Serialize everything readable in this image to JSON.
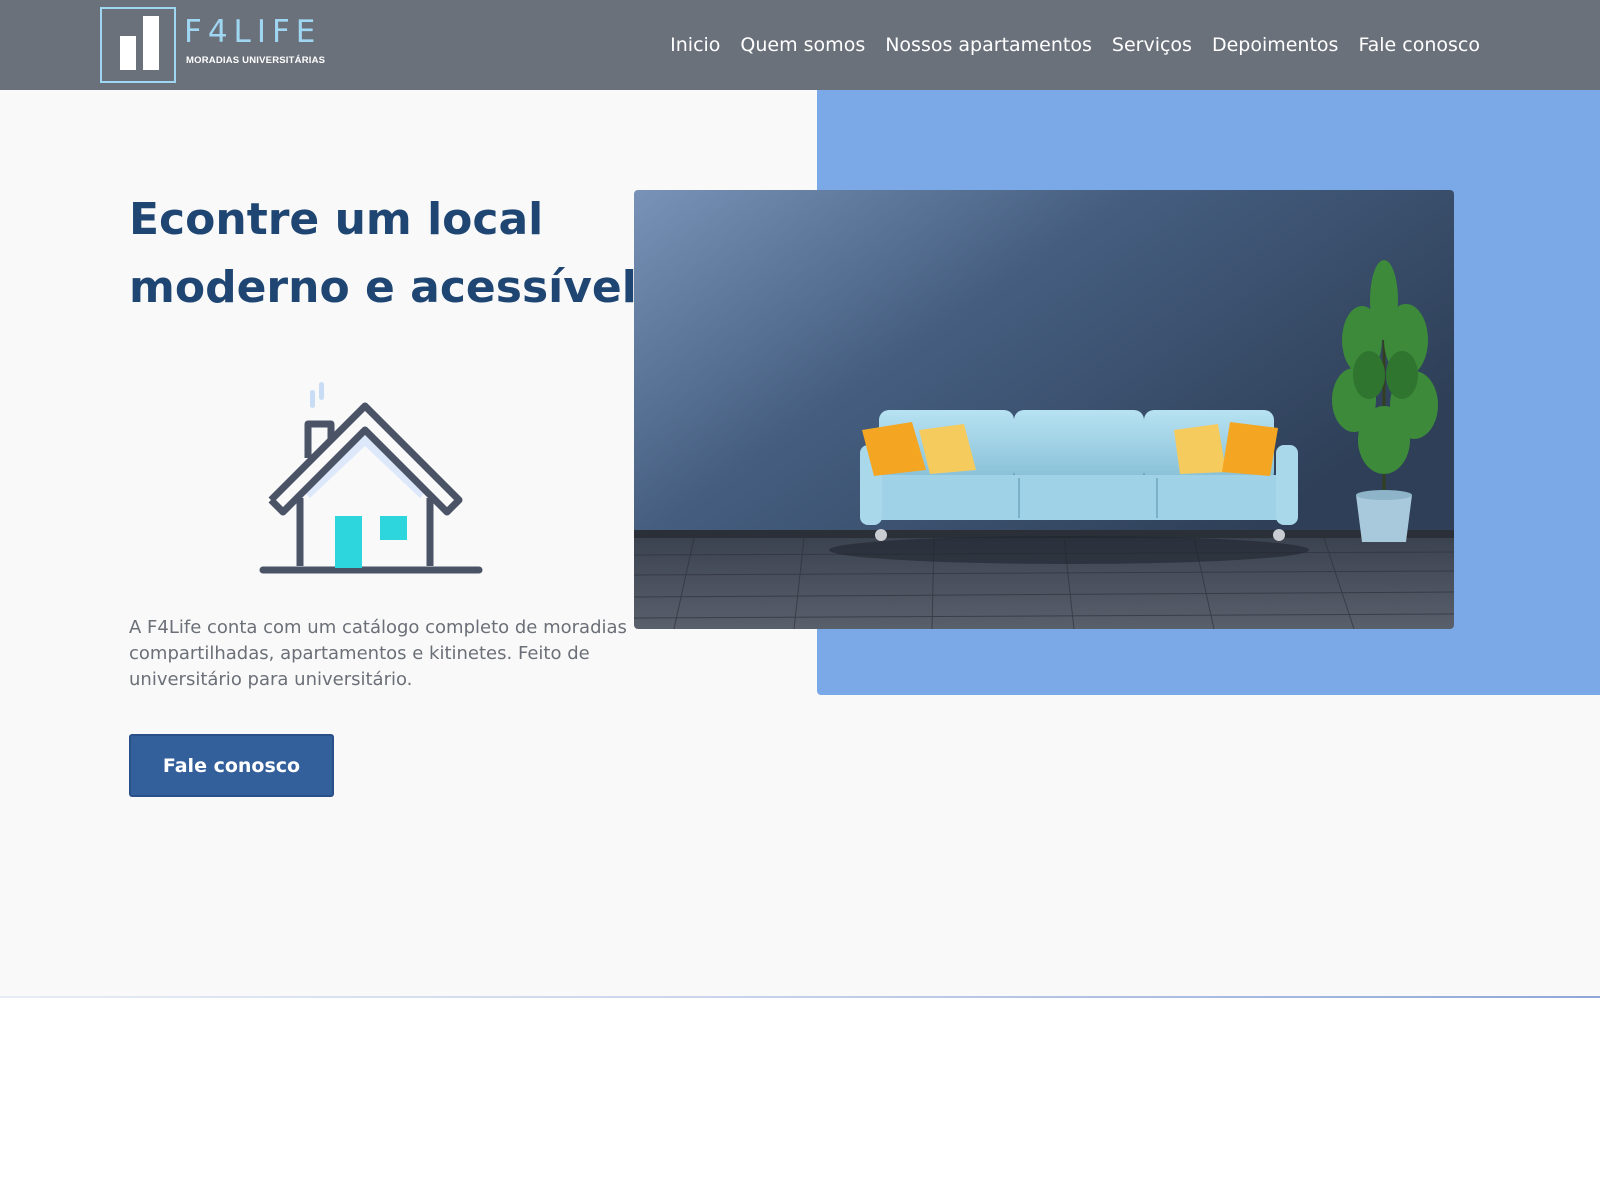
{
  "brand": {
    "name": "F4LIFE",
    "tagline": "MORADIAS UNIVERSITÁRIAS",
    "accent_color": "#9fd6f2"
  },
  "nav": {
    "items": [
      {
        "label": "Inicio"
      },
      {
        "label": "Quem somos"
      },
      {
        "label": "Nossos apartamentos"
      },
      {
        "label": "Serviços"
      },
      {
        "label": "Depoimentos"
      },
      {
        "label": "Fale conosco"
      }
    ]
  },
  "hero": {
    "title": "Econtre um local moderno e acessível",
    "icon": "house-icon",
    "description": "A F4Life conta com um catálogo completo de moradias compartilhadas, apartamentos e kitinetes. Feito de universitário para universitário.",
    "cta_label": "Fale conosco",
    "image": "living-room-photo",
    "colors": {
      "title": "#1f4672",
      "panel": "#7ba9e7",
      "button": "#335f9b",
      "header": "#6b717b"
    }
  }
}
